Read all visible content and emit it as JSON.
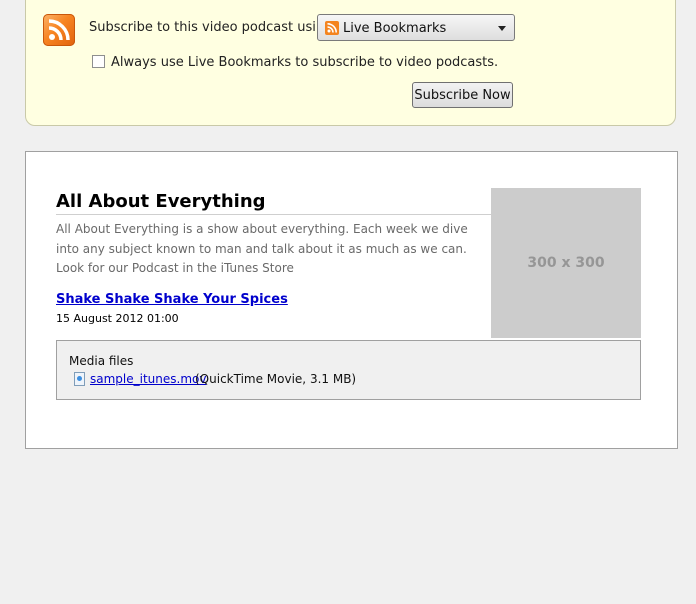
{
  "subscribe": {
    "label": "Subscribe to this video podcast using",
    "reader_selected": "Live Bookmarks",
    "always_label": "Always use Live Bookmarks to subscribe to video podcasts.",
    "always_checked": false,
    "button_label": "Subscribe Now"
  },
  "feed": {
    "title": "All About Everything",
    "description": "All About Everything is a show about everything. Each week we dive into any subject known to man and talk about it as much as we can. Look for our Podcast in the iTunes Store",
    "image_placeholder": "300 x 300",
    "entry": {
      "title": "Shake Shake Shake Your Spices",
      "date": "15 August 2012 01:00"
    },
    "media": {
      "heading": "Media files",
      "file_name": "sample_itunes.mov",
      "file_info": "(QuickTime Movie, 3.1 MB)"
    }
  },
  "colors": {
    "subscribe_bg": "#ffffe1",
    "link": "#0000cc",
    "rss_orange": "#f78422"
  }
}
